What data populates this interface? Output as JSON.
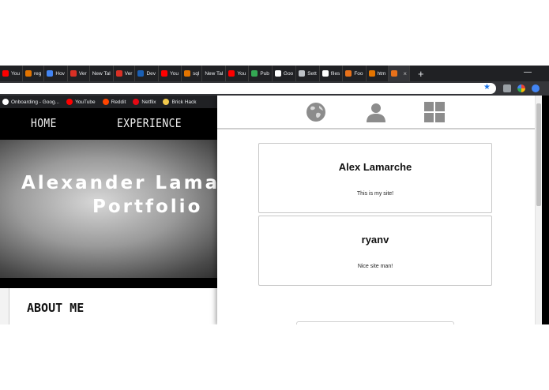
{
  "tabs": [
    {
      "label": "You",
      "icon": "youtube-icon",
      "color": "#ff0000"
    },
    {
      "label": "reg",
      "icon": "flame-icon",
      "color": "#e37400"
    },
    {
      "label": "Hov",
      "icon": "f-logo-icon",
      "color": "#4285f4"
    },
    {
      "label": "Ver",
      "icon": "gmail-icon",
      "color": "#d93025"
    },
    {
      "label": "New Tal",
      "icon": "",
      "color": ""
    },
    {
      "label": "Ver",
      "icon": "gmail-icon",
      "color": "#d93025"
    },
    {
      "label": "Dev",
      "icon": "d-logo-icon",
      "color": "#1a5fb4"
    },
    {
      "label": "You",
      "icon": "youtube-icon",
      "color": "#ff0000"
    },
    {
      "label": "sql",
      "icon": "flame-icon",
      "color": "#e37400"
    },
    {
      "label": "New Tal",
      "icon": "",
      "color": ""
    },
    {
      "label": "You",
      "icon": "youtube-icon",
      "color": "#ff0000"
    },
    {
      "label": "Pub",
      "icon": "chrome-icon",
      "color": "#34a853"
    },
    {
      "label": "Goo",
      "icon": "google-icon",
      "color": "#ffffff"
    },
    {
      "label": "Sett",
      "icon": "gear-icon",
      "color": "#bdc1c6"
    },
    {
      "label": "files",
      "icon": "google-icon",
      "color": "#ffffff"
    },
    {
      "label": "Foo",
      "icon": "r-logo-icon",
      "color": "#e8711a"
    },
    {
      "label": "htm",
      "icon": "flame-icon",
      "color": "#e37400"
    },
    {
      "label": "",
      "icon": "r-logo-icon",
      "color": "#e8711a",
      "active": true
    }
  ],
  "bookmarks": [
    {
      "label": "Onboarding - Goog...",
      "icon": "google-icon",
      "color": "#ffffff"
    },
    {
      "label": "YouTube",
      "icon": "youtube-icon",
      "color": "#ff0000"
    },
    {
      "label": "Reddit",
      "icon": "reddit-icon",
      "color": "#ff4500"
    },
    {
      "label": "Netflix",
      "icon": "netflix-icon",
      "color": "#e50914"
    },
    {
      "label": "Brick Hack",
      "icon": "folder-icon",
      "color": "#f2c94c"
    }
  ],
  "site": {
    "nav": {
      "home": "HOME",
      "experience": "EXPERIENCE"
    },
    "hero": {
      "line1": "Alexander Lamarche's",
      "line2": "Portfolio"
    },
    "about_title": "ABOUT ME"
  },
  "popup": {
    "nav_icons": [
      "globe-icon",
      "person-icon",
      "grid-icon"
    ],
    "comments": [
      {
        "author": "Alex Lamarche",
        "text": "This is my site!"
      },
      {
        "author": "ryanv",
        "text": "Nice site man!"
      }
    ]
  }
}
